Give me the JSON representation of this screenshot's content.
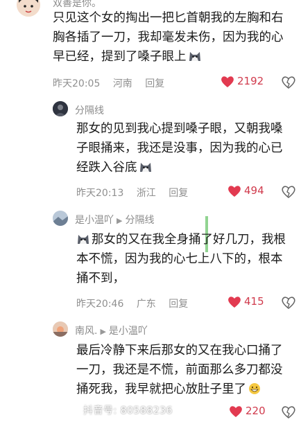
{
  "comments": [
    {
      "name": "双善是你。",
      "reply_to": "",
      "lines": [
        "只见这个女的掏出一把匕首朝我的左胸和右",
        "胸各插了一刀，我却毫发未伤，因为我的心",
        "早已经，提到了嗓子眼上"
      ],
      "time": "昨天20:05",
      "location": "河南",
      "reply_label": "回复",
      "likes": "2192"
    },
    {
      "name": "分隔线",
      "reply_to": "",
      "lines": [
        "那女的见到我心提到嗓子眼，又朝我嗓",
        "子眼捅来，我还是没事，因为我的心已",
        "经跌入谷底"
      ],
      "time": "昨天20:13",
      "location": "浙江",
      "reply_label": "回复",
      "likes": "494"
    },
    {
      "name": "是小温吖",
      "reply_to": "分隔线",
      "lines": [
        "那女的又在我全身捅了好几刀，我根",
        "本不慌，因为我的心七上八下的，根本",
        "捅不到，"
      ],
      "time": "昨天20:46",
      "location": "广东",
      "reply_label": "回复",
      "likes": "415"
    },
    {
      "name": "南风.",
      "reply_to": "是小温吖",
      "lines": [
        "最后冷静下来后那女的又在我心口捅了",
        "一刀，我还是不慌，前面那么多刀都没",
        "捅死我，我早就把心放肚子里了"
      ],
      "time": "",
      "location": "",
      "reply_label": "",
      "likes": "220"
    }
  ],
  "watermark": "抖音号: 80588236",
  "colors": {
    "heart": "#e23a50",
    "text": "#1a1a1a",
    "meta": "#8f8f8f"
  },
  "icons": [
    "heart-icon",
    "dislike-heart-icon",
    "reply-arrow-icon",
    "husky-emoji",
    "grin-emoji"
  ]
}
